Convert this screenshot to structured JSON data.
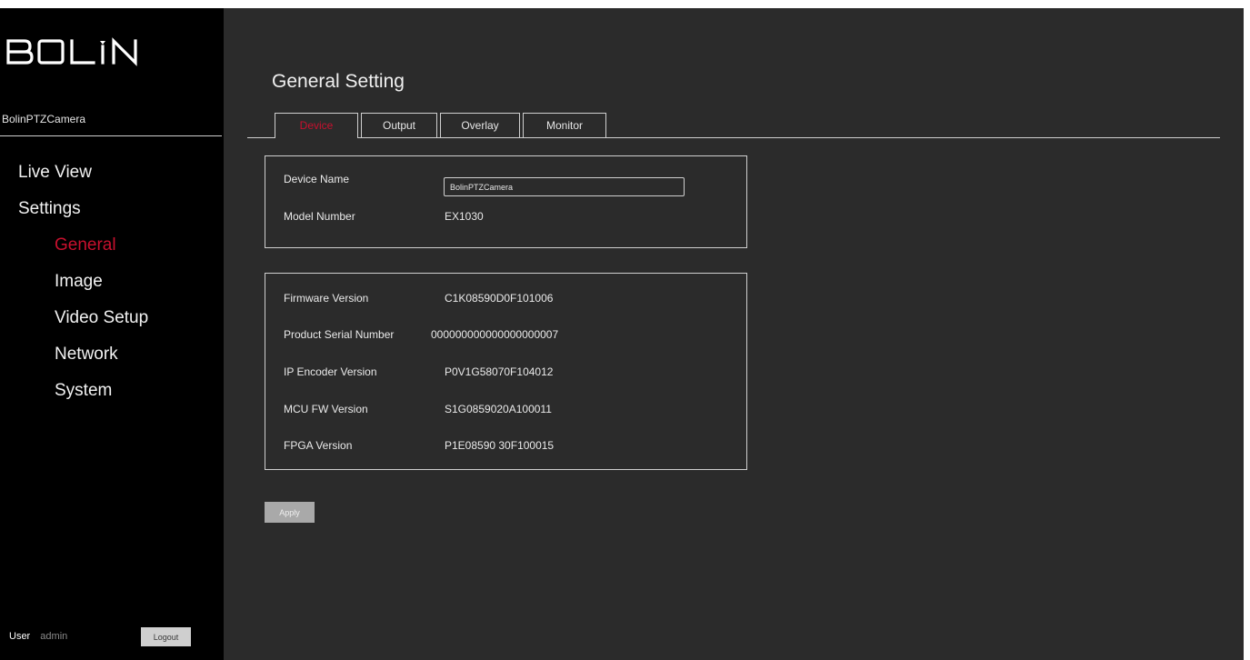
{
  "brand": {
    "logo_text": "BOLIN"
  },
  "sidebar": {
    "device_name": "BolinPTZCamera",
    "nav": [
      {
        "label": "Live View"
      },
      {
        "label": "Settings"
      },
      {
        "label": "General"
      },
      {
        "label": "Image"
      },
      {
        "label": "Video Setup"
      },
      {
        "label": "Network"
      },
      {
        "label": "System"
      }
    ],
    "active_item": "General",
    "user_label": "User",
    "user_name": "admin",
    "logout_label": "Logout"
  },
  "main": {
    "title": "General Setting",
    "tabs": [
      {
        "label": "Device"
      },
      {
        "label": "Output"
      },
      {
        "label": "Overlay"
      },
      {
        "label": "Monitor"
      }
    ],
    "active_tab": "Device",
    "device_panel": {
      "device_name_label": "Device Name",
      "device_name_value": "BolinPTZCamera",
      "model_number_label": "Model Number",
      "model_number_value": "EX1030"
    },
    "version_panel": {
      "rows": [
        {
          "label": "Firmware Version",
          "value": "C1K08590D0F101006"
        },
        {
          "label": "Product Serial Number",
          "value": "000000000000000000007"
        },
        {
          "label": "IP Encoder Version",
          "value": "P0V1G58070F104012"
        },
        {
          "label": "MCU FW Version",
          "value": "S1G0859020A100011"
        },
        {
          "label": "FPGA Version",
          "value": "P1E08590 30F100015"
        }
      ]
    },
    "apply_label": "Apply"
  },
  "colors": {
    "sidebar_bg": "#000000",
    "main_bg": "#2b2b2b",
    "accent_red": "#c8102e",
    "border": "#cfcfcf"
  }
}
